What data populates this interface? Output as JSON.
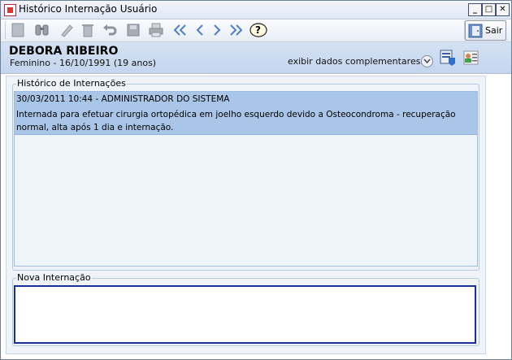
{
  "window": {
    "title": "Histórico Internação Usuário"
  },
  "toolbar": {
    "sair_label": "Sair"
  },
  "patient": {
    "name": "DEBORA RIBEIRO",
    "info": "Feminino - 16/10/1991 (19 anos)",
    "more_link": "exibir dados complementares..."
  },
  "history": {
    "legend": "Histórico de Internações",
    "entries": [
      {
        "header": "30/03/2011 10:44 - ADMINISTRADOR DO SISTEMA",
        "text": "Internada para efetuar cirurgia ortopédica em joelho esquerdo devido a Osteocondroma - recuperação normal, alta após 1 dia e internação."
      }
    ]
  },
  "nova": {
    "legend": "Nova Internação",
    "value": ""
  },
  "colors": {
    "selected_row": "#a9c5e8",
    "input_border": "#1a2f9a",
    "header_band": "#c9d9ef"
  },
  "icons": [
    "new-icon",
    "search-icon",
    "edit-icon",
    "delete-icon",
    "undo-icon",
    "save-icon",
    "print-icon",
    "first-icon",
    "prev-icon",
    "next-icon",
    "last-icon",
    "help-icon",
    "exit-icon",
    "patient-card-icon",
    "patient-record-icon",
    "chevron-down-icon"
  ]
}
